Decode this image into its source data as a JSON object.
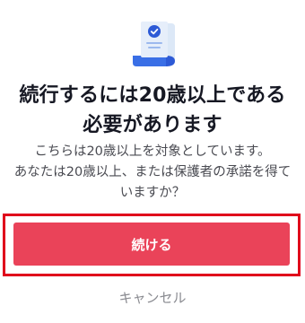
{
  "illustration": {
    "icon": "verified-certificate-icon",
    "colors": {
      "paper": "#dce8f7",
      "roll": "#3a6fe6",
      "badge": "#2d5ad6",
      "lines": "#9cb9ee"
    }
  },
  "dialog": {
    "title": "続行するには20歳以上である必要があります",
    "description": "こちらは20歳以上を対象としています。\nあなたは20歳以上、または保護者の承諾を得ていますか？"
  },
  "actions": {
    "continue_label": "続ける",
    "cancel_label": "キャンセル"
  },
  "colors": {
    "primary": "#ea4359",
    "highlight_border": "#e0001b",
    "title_text": "#161823",
    "body_text": "#4a4b52",
    "cancel_text": "#8a8b91"
  }
}
